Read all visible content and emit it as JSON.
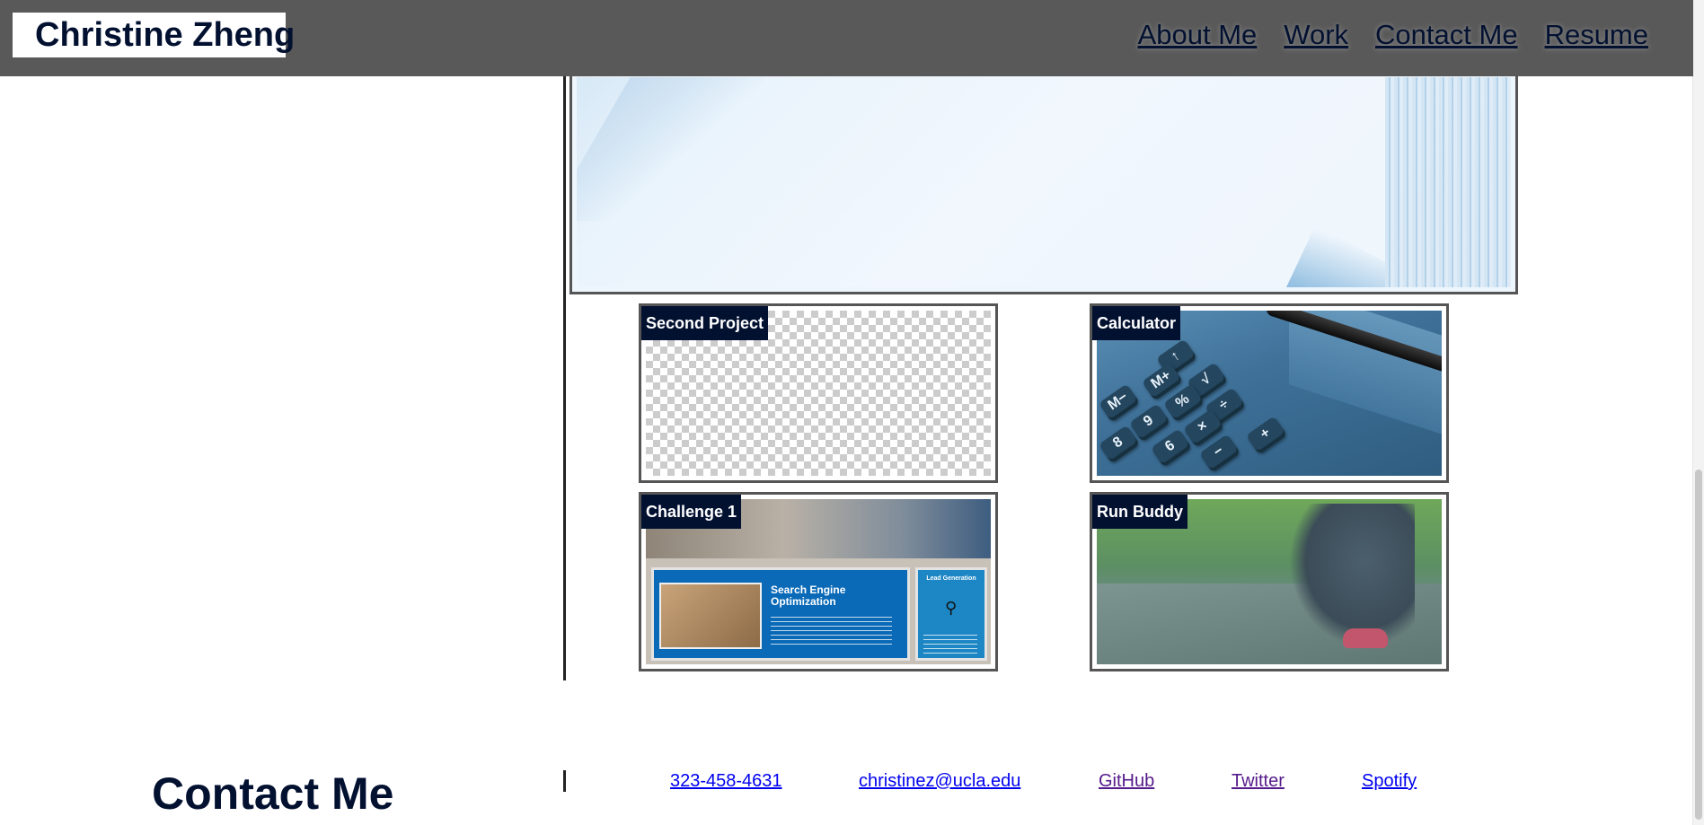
{
  "header": {
    "brand": "Christine Zheng",
    "nav": [
      "About Me",
      "Work",
      "Contact Me",
      "Resume"
    ]
  },
  "work": {
    "projects": [
      {
        "label": "Second Project",
        "image": "transparent-checkerboard"
      },
      {
        "label": "Calculator",
        "image": "calculator-keys-photo"
      },
      {
        "label": "Challenge 1",
        "image": "seo-webpage-screenshot",
        "inner_text": {
          "title": "Search Engine Optimization",
          "sidebar": "Lead Generation"
        }
      },
      {
        "label": "Run Buddy",
        "image": "runner-tying-shoe-photo"
      }
    ]
  },
  "contact": {
    "title": "Contact Me",
    "links": [
      {
        "text": "323-458-4631"
      },
      {
        "text": "christinez@ucla.edu"
      },
      {
        "text": "GitHub"
      },
      {
        "text": "Twitter"
      },
      {
        "text": "Spotify"
      }
    ]
  },
  "colors": {
    "header_bg": "#595959",
    "brand_text": "#031131",
    "label_bg": "#031131",
    "link": "#0000ee",
    "visited_link": "#551a8b"
  }
}
